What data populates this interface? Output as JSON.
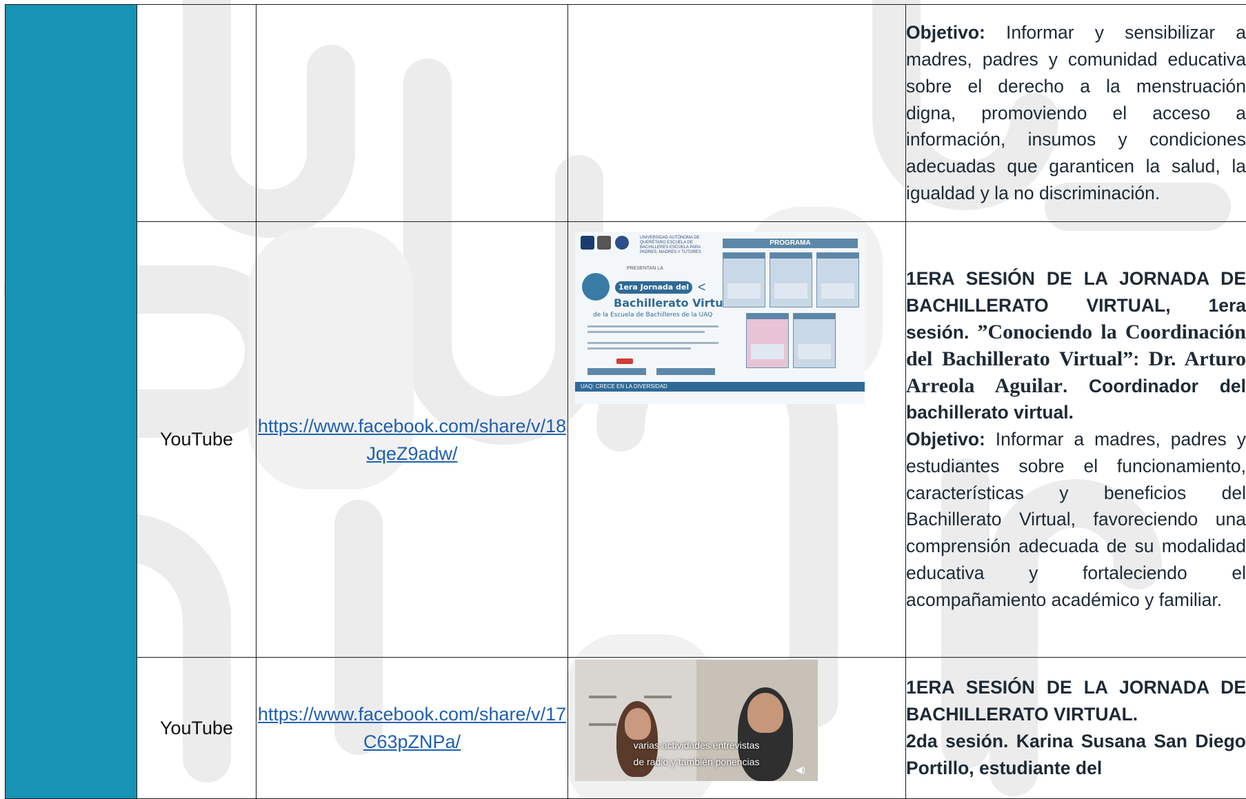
{
  "rows": [
    {
      "platform": "",
      "link": "",
      "description": [
        {
          "text": "Objetivo: ",
          "bold": true
        },
        {
          "text": "Informar y sensibilizar a madres, padres y comunidad educativa sobre el derecho a la menstruación digna, promoviendo el acceso a información, insumos y condiciones adecuadas que garanticen la salud, la igualdad y la no discriminación.",
          "bold": false
        }
      ]
    },
    {
      "platform": "YouTube",
      "link": "https://www.facebook.com/share/v/18JqeZ9adw/",
      "poster": {
        "university": "UNIVERSIDAD AUTÓNOMA DE QUERÉTARO ESCUELA DE BACHILLERES ESCUELA PARA PADRES, MADRES Y TUTORES",
        "presents": "PRESENTAN LA",
        "jornada": "1era Jornada del",
        "bachillerato": "Bachillerato Virtual",
        "escuela": "de la Escuela de Bachilleres de la UAQ",
        "programa": "PROGRAMA",
        "footer": "UAQ: CRECE EN LA DIVERSIDAD"
      },
      "description": [
        {
          "text": "1ERA SESIÓN DE LA JORNADA DE BACHILLERATO VIRTUAL, 1era sesión. ",
          "bold": true
        },
        {
          "text": "”Conociendo la Coordinación del Bachillerato Virtual”",
          "serif": true
        },
        {
          "text": ": ",
          "bold": true
        },
        {
          "text": "Dr. Arturo Arreola Aguilar",
          "serif": true
        },
        {
          "text": ". Coordinador del bachillerato virtual.",
          "bold": true
        },
        {
          "text": "Objetivo: ",
          "bold": true,
          "newline": true
        },
        {
          "text": "Informar a madres, padres y estudiantes sobre el funcionamiento, características y beneficios del Bachillerato Virtual, favoreciendo una comprensión adecuada de su modalidad educativa y fortaleciendo el acompañamiento académico y familiar.",
          "bold": false
        }
      ]
    },
    {
      "platform": "YouTube",
      "link": "https://www.facebook.com/share/v/17C63pZNPa/",
      "video": {
        "caption_line1": "varias actividades entrevistas",
        "caption_line2": "de radio y también ponencias"
      },
      "description": [
        {
          "text": "1ERA SESIÓN DE LA JORNADA DE BACHILLERATO VIRTUAL.",
          "bold": true
        },
        {
          "text": "2da sesión. Karina Susana San Diego Portillo, estudiante del",
          "bold": true,
          "newline": true
        }
      ]
    }
  ]
}
